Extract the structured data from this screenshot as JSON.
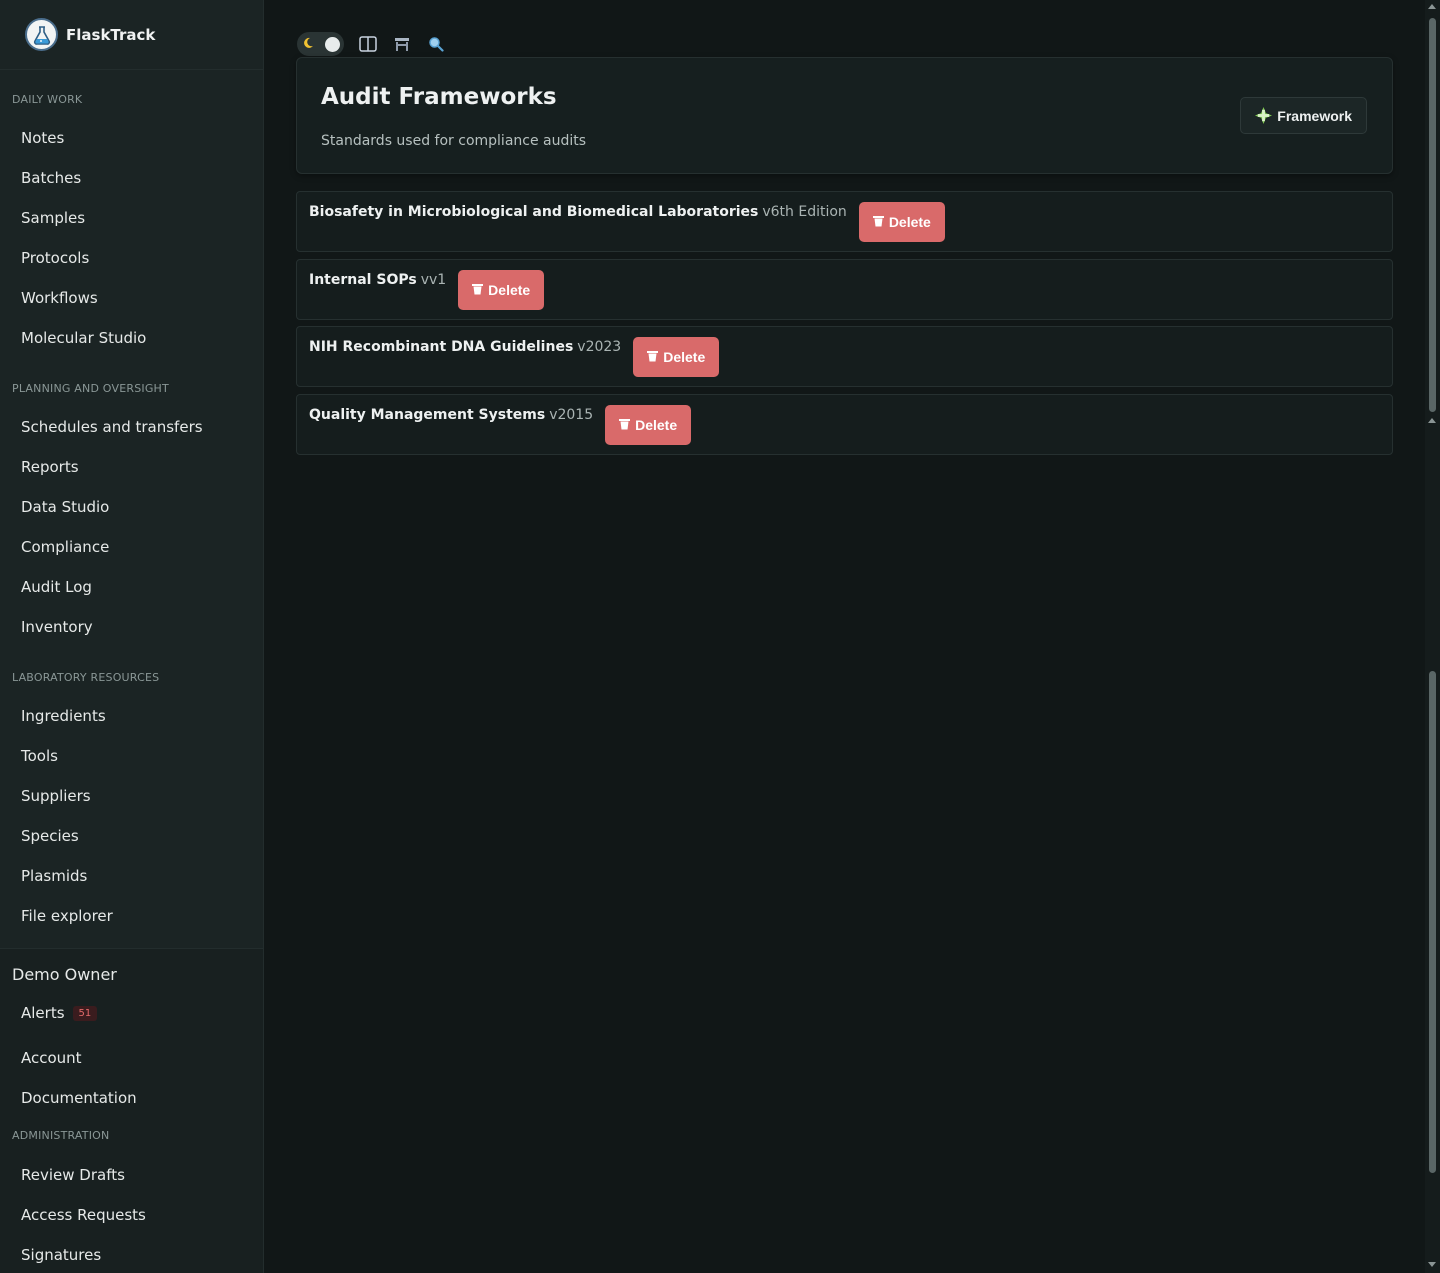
{
  "app": {
    "name": "FlaskTrack"
  },
  "sidebar": {
    "sections": [
      {
        "label": "DAILY WORK",
        "items": [
          "Notes",
          "Batches",
          "Samples",
          "Protocols",
          "Workflows",
          "Molecular Studio"
        ]
      },
      {
        "label": "PLANNING AND OVERSIGHT",
        "items": [
          "Schedules and transfers",
          "Reports",
          "Data Studio",
          "Compliance",
          "Audit Log",
          "Inventory"
        ]
      },
      {
        "label": "LABORATORY RESOURCES",
        "items": [
          "Ingredients",
          "Tools",
          "Suppliers",
          "Species",
          "Plasmids",
          "File explorer"
        ]
      }
    ],
    "user": {
      "name": "Demo Owner",
      "alerts_label": "Alerts",
      "alerts_count": "51",
      "account_label": "Account",
      "documentation_label": "Documentation"
    },
    "admin": {
      "label": "ADMINISTRATION",
      "items": [
        "Review Drafts",
        "Access Requests",
        "Signatures"
      ]
    }
  },
  "header": {
    "title": "Audit Frameworks",
    "subtitle": "Standards used for compliance audits",
    "add_label": "Framework"
  },
  "frameworks": [
    {
      "name": "Biosafety in Microbiological and Biomedical Laboratories",
      "version": "v6th Edition",
      "delete_label": "Delete"
    },
    {
      "name": "Internal SOPs",
      "version": "vv1",
      "delete_label": "Delete"
    },
    {
      "name": "NIH Recombinant DNA Guidelines",
      "version": "v2023",
      "delete_label": "Delete"
    },
    {
      "name": "Quality Management Systems",
      "version": "v2015",
      "delete_label": "Delete"
    }
  ],
  "colors": {
    "background": "#111717",
    "sidebar": "#1b2424",
    "danger": "#d96a6a",
    "accent": "#7ec850"
  },
  "icons": {
    "theme": "moon-icon",
    "layout": "columns-icon",
    "bench": "bench-icon",
    "search": "search-icon",
    "add": "plus-icon",
    "delete": "trash-icon"
  }
}
